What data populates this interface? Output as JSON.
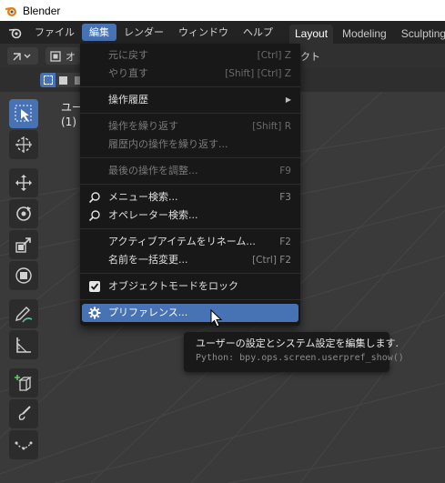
{
  "titlebar": {
    "title": "Blender"
  },
  "menubar": {
    "items": [
      "ファイル",
      "編集",
      "レンダー",
      "ウィンドウ",
      "ヘルプ"
    ],
    "active_index": 1
  },
  "workspaces": {
    "tabs": [
      "Layout",
      "Modeling",
      "Sculpting"
    ],
    "active": "Layout"
  },
  "header": {
    "partial_label_1": "オ",
    "partial_label_2": "クト"
  },
  "viewport": {
    "overlay_line1": "ユー",
    "overlay_line2": "(1)"
  },
  "edit_menu": {
    "undo": {
      "label": "元に戻す",
      "shortcut": "[Ctrl] Z"
    },
    "redo": {
      "label": "やり直す",
      "shortcut": "[Shift] [Ctrl] Z"
    },
    "undo_history": {
      "label": "操作履歴"
    },
    "repeat_last": {
      "label": "操作を繰り返す",
      "shortcut": "[Shift] R"
    },
    "repeat_history": {
      "label": "履歴内の操作を繰り返す..."
    },
    "adjust_last": {
      "label": "最後の操作を調整...",
      "shortcut": "F9"
    },
    "menu_search": {
      "label": "メニュー検索...",
      "shortcut": "F3"
    },
    "operator_search": {
      "label": "オペレーター検索..."
    },
    "rename_active": {
      "label": "アクティブアイテムをリネーム...",
      "shortcut": "F2"
    },
    "batch_rename": {
      "label": "名前を一括変更...",
      "shortcut": "[Ctrl] F2"
    },
    "lock_object_modes": {
      "label": "オブジェクトモードをロック",
      "checked": true
    },
    "preferences": {
      "label": "プリファレンス..."
    }
  },
  "tooltip": {
    "description": "ユーザーの設定とシステム設定を編集します.",
    "python": "Python: bpy.ops.screen.userpref_show()"
  },
  "colors": {
    "accent": "#4772b3",
    "menu_bg": "#181818",
    "viewport_bg": "#3a3a3a"
  }
}
